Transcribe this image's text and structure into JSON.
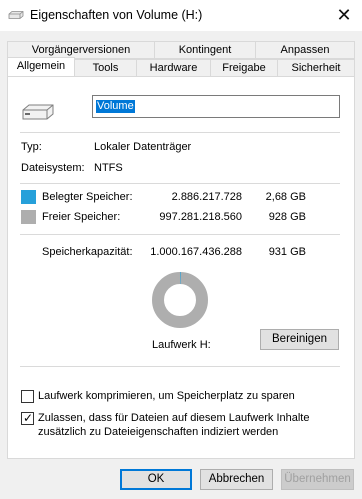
{
  "window": {
    "title": "Eigenschaften von Volume (H:)",
    "close_icon": "close-icon"
  },
  "tabs": {
    "row1": [
      "Vorgängerversionen",
      "Kontingent",
      "Anpassen"
    ],
    "row2": [
      "Allgemein",
      "Tools",
      "Hardware",
      "Freigabe",
      "Sicherheit"
    ],
    "active": "Allgemein"
  },
  "general": {
    "volume_name": "Volume",
    "type_label": "Typ:",
    "type_value": "Lokaler Datenträger",
    "fs_label": "Dateisystem:",
    "fs_value": "NTFS"
  },
  "usage": {
    "used": {
      "label": "Belegter Speicher:",
      "bytes": "2.886.217.728",
      "size": "2,68 GB",
      "color": "#26a0da"
    },
    "free": {
      "label": "Freier Speicher:",
      "bytes": "997.281.218.560",
      "size": "928 GB",
      "color": "#aeaeae"
    },
    "capacity": {
      "label": "Speicherkapazität:",
      "bytes": "1.000.167.436.288",
      "size": "931 GB"
    },
    "used_fraction": 0.00289
  },
  "drive_label": "Laufwerk H:",
  "cleanup_button": "Bereinigen",
  "options": {
    "compress": {
      "label": "Laufwerk komprimieren, um Speicherplatz zu sparen",
      "checked": false
    },
    "index_line1": "Zulassen, dass für Dateien auf diesem Laufwerk Inhalte",
    "index_line2": "zusätzlich zu Dateieigenschaften indiziert werden",
    "index_checked": true
  },
  "buttons": {
    "ok": "OK",
    "cancel": "Abbrechen",
    "apply": "Übernehmen"
  }
}
